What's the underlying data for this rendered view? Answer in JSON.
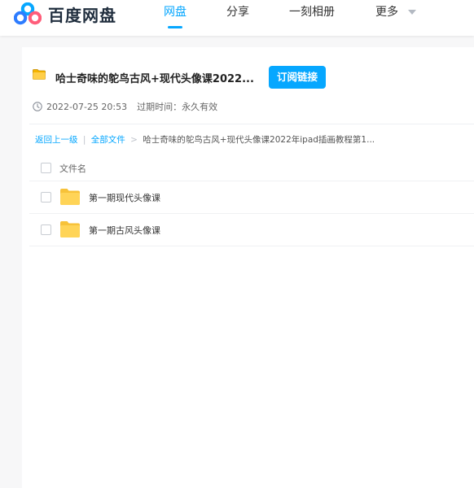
{
  "app": {
    "name": "百度网盘"
  },
  "nav": {
    "items": [
      {
        "label": "网盘",
        "active": true
      },
      {
        "label": "分享",
        "active": false
      },
      {
        "label": "一刻相册",
        "active": false
      },
      {
        "label": "更多",
        "active": false
      }
    ]
  },
  "share": {
    "title": "哈士奇味的鸵鸟古风+现代头像课2022...",
    "subscribe_label": "订阅链接",
    "date": "2022-07-25 20:53",
    "expire_label": "过期时间：",
    "expire_value": "永久有效"
  },
  "breadcrumb": {
    "back": "返回上一级",
    "divider": "|",
    "all_files": "全部文件",
    "arrow": ">",
    "current": "哈士奇味的鸵鸟古风+现代头像课2022年ipad插画教程第1..."
  },
  "list": {
    "header": "文件名",
    "rows": [
      {
        "name": "第一期现代头像课",
        "icon": "folder-icon"
      },
      {
        "name": "第一期古风头像课",
        "icon": "folder-icon"
      }
    ]
  },
  "colors": {
    "accent": "#06a7ff",
    "folder": "#ffcf4a",
    "background": "#f7f7f8"
  }
}
